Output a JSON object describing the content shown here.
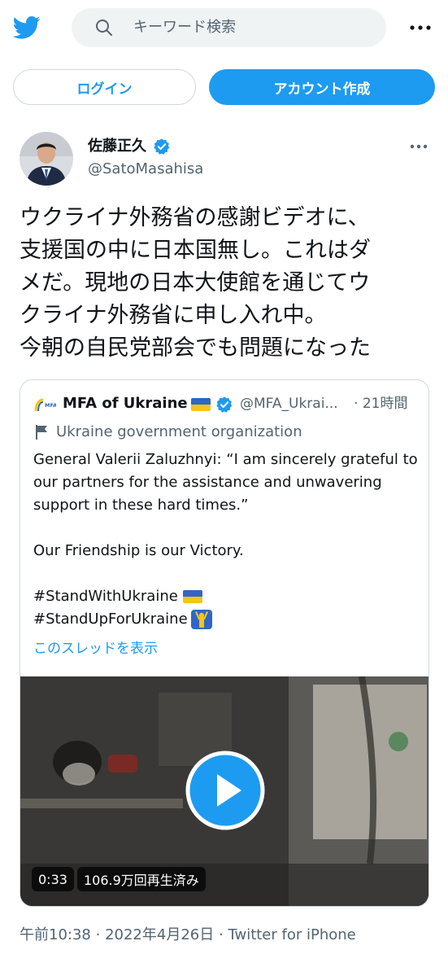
{
  "search": {
    "placeholder": "キーワード検索"
  },
  "buttons": {
    "login": "ログイン",
    "signup": "アカウント作成"
  },
  "tweet": {
    "author_name": "佐藤正久",
    "author_handle": "@SatoMasahisa",
    "text": "ウクライナ外務省の感謝ビデオに、\n支援国の中に日本国無し。これはダ\nメだ。現地の日本大使館を通じてウ\nクライナ外務省に申し入れ中。\n今朝の自民党部会でも問題になった",
    "time": "午前10:38",
    "date": "2022年4月26日",
    "client": "Twitter for iPhone",
    "separator": "·"
  },
  "quote": {
    "name": "MFA of Ukraine",
    "handle": "@MFA_Ukrai...",
    "time_sep": "·",
    "time": "21時間",
    "org_label": "Ukraine government organization",
    "body_line1": "General Valerii Zaluzhnyi: “I am sincerely grateful to our partners for the assistance and unwavering support in these hard times.”",
    "body_line2": "Our Friendship is our Victory.",
    "hashtag1": "#StandWithUkraine",
    "hashtag2": "#StandUpForUkraine",
    "thread_link": "このスレッドを表示",
    "video_duration": "0:33",
    "video_views": "106.9万回再生済み",
    "logo_text": "MFA"
  },
  "colors": {
    "twitter_blue": "#1d9bf0",
    "ukraine_blue": "#2f66c8",
    "ukraine_yellow": "#f5c518",
    "text_secondary": "#536471"
  },
  "icons": {
    "logo": "twitter-bird-icon",
    "search": "search-icon",
    "more": "more-dots-icon",
    "verified": "verified-badge-icon",
    "org": "flag-icon",
    "play": "play-icon"
  }
}
